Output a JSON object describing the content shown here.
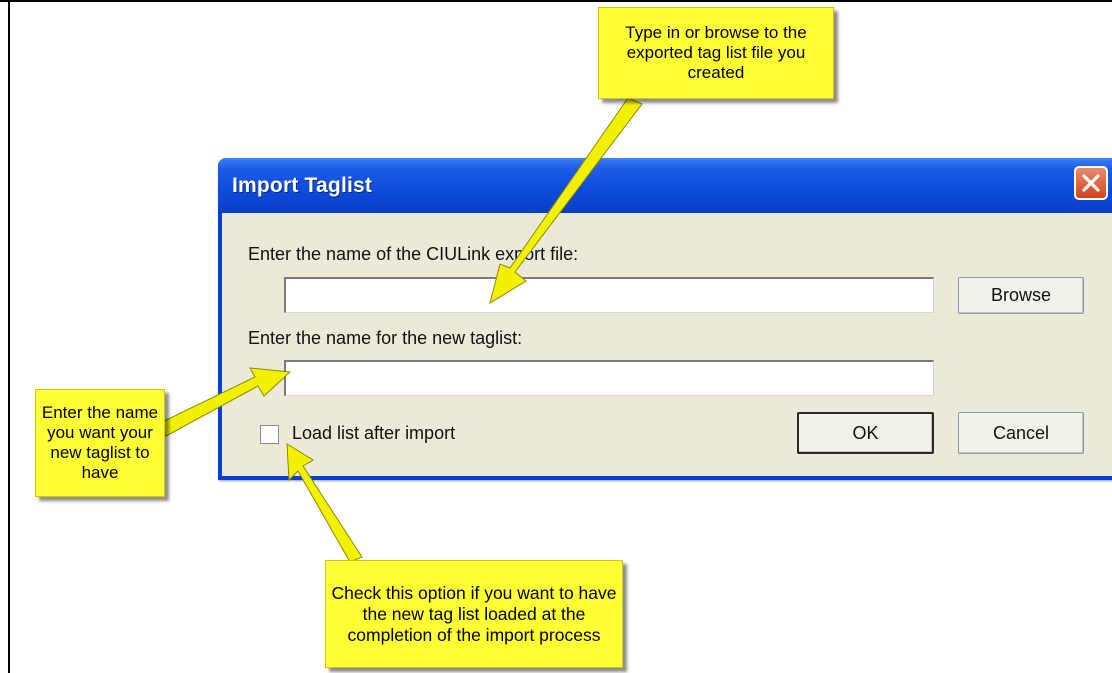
{
  "dialog": {
    "title": "Import Taglist",
    "export_file_label": "Enter the name of the CIULink export file:",
    "export_file_value": "",
    "taglist_label": "Enter the name for the new taglist:",
    "taglist_value": "",
    "browse_label": "Browse",
    "load_checkbox_label": "Load list after import",
    "load_checkbox_checked": false,
    "ok_label": "OK",
    "cancel_label": "Cancel"
  },
  "callouts": {
    "top": "Type in or browse to the exported tag list file you created",
    "left": "Enter the name you want your new taglist to have",
    "bottom": "Check this option if you want to have the new tag list loaded at the completion of the import process"
  },
  "colors": {
    "callout": "#ffff33",
    "arrow": "#f2f200",
    "titlebar": "#0c48d8",
    "dialog_bg": "#ece9d8"
  }
}
